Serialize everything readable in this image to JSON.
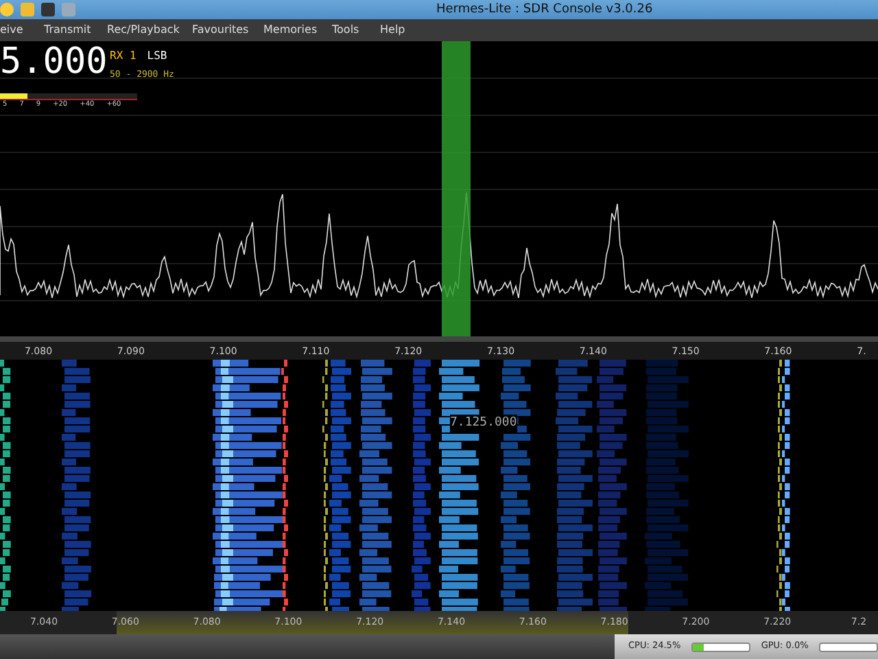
{
  "window": {
    "title": "Hermes-Lite : SDR Console v3.0.26"
  },
  "menu": [
    "eive",
    "Transmit",
    "Rec/Playback",
    "Favourites",
    "Memories",
    "Tools",
    "Help"
  ],
  "receiver": {
    "frequency": "5.000",
    "rx": "RX 1",
    "mode": "LSB",
    "filter": "50 - 2900 Hz",
    "smeter": {
      "level": 0.2,
      "scale": [
        "5",
        "7",
        "9",
        "+20",
        "+40",
        "+60"
      ]
    }
  },
  "spectrum_axis": [
    "7.080",
    "7.090",
    "7.100",
    "7.110",
    "7.120",
    "7.130",
    "7.140",
    "7.150",
    "7.160",
    "7."
  ],
  "waterfall": {
    "cursor_label": "7.125.000"
  },
  "overview_axis": [
    "7.040",
    "7.060",
    "7.080",
    "7.100",
    "7.120",
    "7.140",
    "7.160",
    "7.180",
    "7.200",
    "7.220",
    "7.2"
  ],
  "status_bar": {
    "meters": [
      {
        "label": "CPU: 24.5%",
        "level": 0.2
      },
      {
        "label": "GPU: 0.0%",
        "level": 0.0
      }
    ]
  }
}
